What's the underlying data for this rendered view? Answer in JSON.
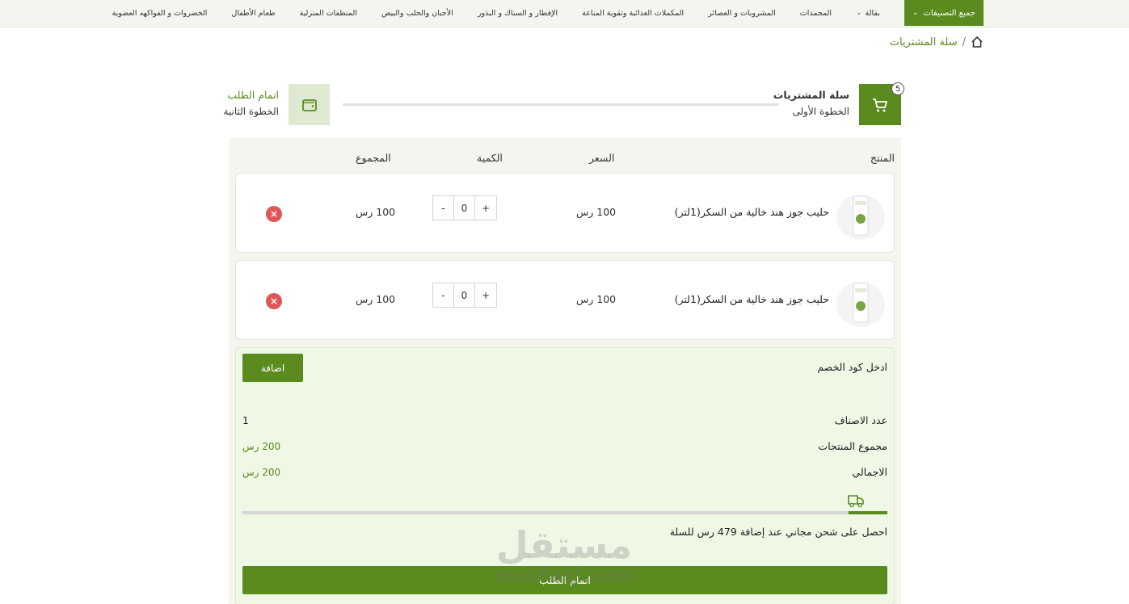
{
  "nav": {
    "all_categories": "جميع التصنيفات",
    "items": [
      "بقالة",
      "المجمدات",
      "المشروبات و العصائر",
      "المكملات الغذائية وتقوية المناعة",
      "الإفطار و السناك و البذور",
      "الأجبان والحلب والبيض",
      "المنظفات المنزلية",
      "طعام الأطفال",
      "الخضروات و الفواكهه العضوية"
    ]
  },
  "breadcrumb": {
    "sep": "/",
    "current": "سلة المشتريات"
  },
  "steps": {
    "badge": "5",
    "step1_title": "سلة المشتريات",
    "step1_sub": "الخطوة الأولى",
    "step2_title": "اتمام الطلب",
    "step2_sub": "الخطوة الثانية"
  },
  "table": {
    "headers": {
      "product": "المنتج",
      "price": "السعر",
      "qty": "الكمية",
      "total": "المجموع"
    },
    "items": [
      {
        "name": "حليب جوز هند خالية من السكر(1لتر)",
        "price": "100 رس",
        "qty": "0",
        "total": "100 رس"
      },
      {
        "name": "حليب جوز هند خالية من السكر(1لتر)",
        "price": "100 رس",
        "qty": "0",
        "total": "100 رس"
      }
    ]
  },
  "summary": {
    "coupon_label": "ادخل كود الخصم",
    "add_button": "اضافة",
    "count_label": "عدد الاصناف",
    "count_value": "1",
    "subtotal_label": "مجموع المنتجات",
    "subtotal_value": "200 رس",
    "total_label": "الاجمالي",
    "total_value": "200 رس",
    "shipping_msg": "احصل على شحن مجاني عند إضافة 479 رس للسلة",
    "checkout_button": "اتمام الطلب"
  },
  "watermark": {
    "line1": "مستقل",
    "line2": "mostaql.com"
  },
  "colors": {
    "primary": "#5b8a1f",
    "panel": "#f3f5ee",
    "summary": "#eff7e5",
    "remove": "#e05656"
  }
}
